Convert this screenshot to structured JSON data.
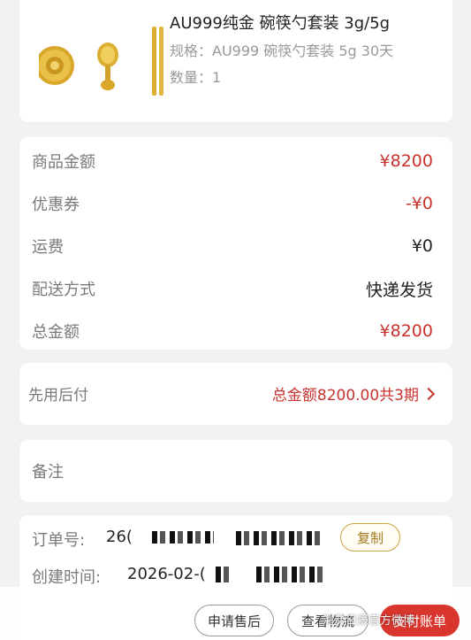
{
  "product": {
    "title": "AU999纯金 碗筷勺套装 3g/5g",
    "spec": "规格：AU999 碗筷勺套装 5g 30天",
    "qty": "数量：1"
  },
  "price": {
    "rows": [
      {
        "label": "商品金额",
        "value": "¥8200"
      },
      {
        "label": "优惠券",
        "value": "-¥0"
      },
      {
        "label": "运费",
        "value": "¥0"
      },
      {
        "label": "配送方式",
        "value": "快递发货"
      },
      {
        "label": "总金额",
        "value": "¥8200"
      }
    ]
  },
  "pay_later": {
    "label": "先用后付",
    "value": "总金额8200.00共3期"
  },
  "remark": {
    "label": "备注"
  },
  "order": {
    "number_label": "订单号:",
    "number_value": "26(",
    "copy_label": "复制",
    "created_label": "创建时间:",
    "created_value": "2026-02-("
  },
  "bottom": {
    "aftersale": "申请售后",
    "logistics": "查看物流",
    "pay": "支付账单",
    "watermark": "消费日报官方微博"
  },
  "colors": {
    "accent_red": "#c8332f",
    "gold": "#c9a440"
  }
}
